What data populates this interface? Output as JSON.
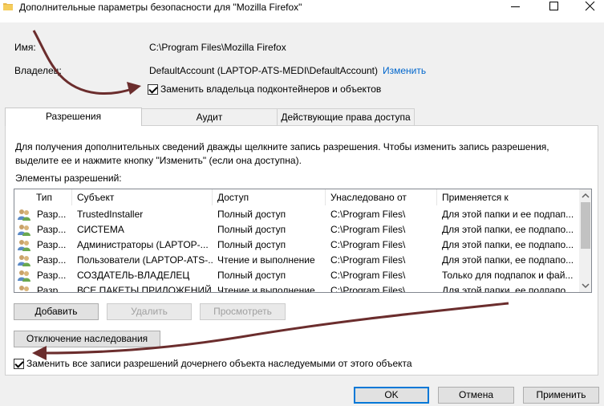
{
  "window": {
    "title": "Дополнительные параметры безопасности  для \"Mozilla Firefox\""
  },
  "info": {
    "name_label": "Имя:",
    "name_value": "C:\\Program Files\\Mozilla Firefox",
    "owner_label": "Владелец:",
    "owner_value": "DefaultAccount (LAPTOP-ATS-MEDI\\DefaultAccount)",
    "change_link": "Изменить",
    "replace_owner_label": "Заменить владельца подконтейнеров и объектов"
  },
  "tabs": [
    {
      "label": "Разрешения"
    },
    {
      "label": "Аудит"
    },
    {
      "label": "Действующие права доступа"
    }
  ],
  "permissions": {
    "hint": "Для получения дополнительных сведений дважды щелкните запись разрешения. Чтобы изменить запись разрешения, выделите ее и нажмите кнопку \"Изменить\" (если она доступна).",
    "entries_label": "Элементы разрешений:",
    "columns": [
      "Тип",
      "Субъект",
      "Доступ",
      "Унаследовано от",
      "Применяется к"
    ],
    "rows": [
      {
        "type": "Разр...",
        "subject": "TrustedInstaller",
        "access": "Полный доступ",
        "inherited": "C:\\Program Files\\",
        "applies": "Для этой папки и ее подпап..."
      },
      {
        "type": "Разр...",
        "subject": "СИСТЕМА",
        "access": "Полный доступ",
        "inherited": "C:\\Program Files\\",
        "applies": "Для этой папки, ее подпапо..."
      },
      {
        "type": "Разр...",
        "subject": "Администраторы (LAPTOP-...",
        "access": "Полный доступ",
        "inherited": "C:\\Program Files\\",
        "applies": "Для этой папки, ее подпапо..."
      },
      {
        "type": "Разр...",
        "subject": "Пользователи (LAPTOP-ATS-...",
        "access": "Чтение и выполнение",
        "inherited": "C:\\Program Files\\",
        "applies": "Для этой папки, ее подпапо..."
      },
      {
        "type": "Разр...",
        "subject": "СОЗДАТЕЛЬ-ВЛАДЕЛЕЦ",
        "access": "Полный доступ",
        "inherited": "C:\\Program Files\\",
        "applies": "Только для подпапок и фай..."
      },
      {
        "type": "Разр...",
        "subject": "ВСЕ ПАКЕТЫ ПРИЛОЖЕНИЙ",
        "access": "Чтение и выполнение",
        "inherited": "C:\\Program Files\\",
        "applies": "Для этой папки, ее подпапо..."
      }
    ],
    "add_button": "Добавить",
    "remove_button": "Удалить",
    "view_button": "Просмотреть",
    "disable_inheritance_button": "Отключение наследования",
    "replace_child_label": "Заменить все записи разрешений дочернего объекта наследуемыми от этого объекта"
  },
  "footer": {
    "ok": "OK",
    "cancel": "Отмена",
    "apply": "Применить"
  },
  "colors": {
    "accent": "#0078d7",
    "link": "#0066cc",
    "annotation_arrow": "#6b2d2d"
  }
}
